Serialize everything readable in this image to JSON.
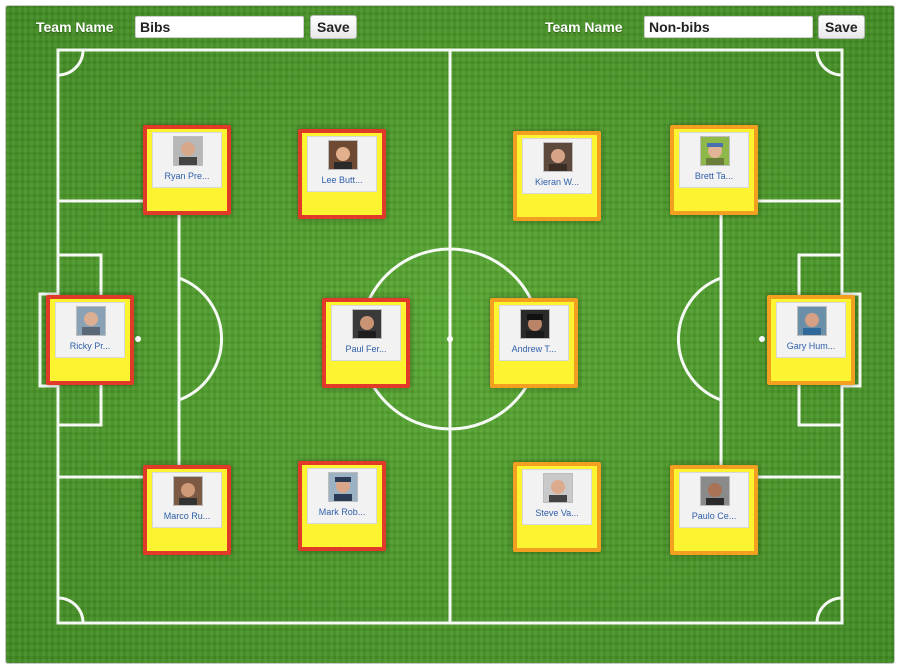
{
  "teams": {
    "left": {
      "label": "Team Name",
      "value": "Bibs",
      "save_label": "Save"
    },
    "right": {
      "label": "Team Name",
      "value": "Non-bibs",
      "save_label": "Save"
    }
  },
  "colors": {
    "bibs_border": "#e23a28",
    "nonbibs_border": "#f3a020",
    "card_fill": "#fcf430",
    "grass": "#4c9a2a",
    "lines": "#ffffff"
  },
  "players": [
    {
      "team": "bibs",
      "name": "Ryan Pre...",
      "icon": "player-avatar-icon"
    },
    {
      "team": "bibs",
      "name": "Lee Butt...",
      "icon": "player-avatar-icon"
    },
    {
      "team": "bibs",
      "name": "Ricky Pr...",
      "icon": "player-avatar-icon"
    },
    {
      "team": "bibs",
      "name": "Paul Fer...",
      "icon": "player-avatar-icon"
    },
    {
      "team": "bibs",
      "name": "Marco Ru...",
      "icon": "player-avatar-icon"
    },
    {
      "team": "bibs",
      "name": "Mark Rob...",
      "icon": "player-avatar-icon"
    },
    {
      "team": "nonbibs",
      "name": "Kieran W...",
      "icon": "player-avatar-icon"
    },
    {
      "team": "nonbibs",
      "name": "Brett Ta...",
      "icon": "player-avatar-icon"
    },
    {
      "team": "nonbibs",
      "name": "Andrew T...",
      "icon": "player-avatar-icon"
    },
    {
      "team": "nonbibs",
      "name": "Gary Hum...",
      "icon": "player-avatar-icon"
    },
    {
      "team": "nonbibs",
      "name": "Steve Va...",
      "icon": "player-avatar-icon"
    },
    {
      "team": "nonbibs",
      "name": "Paulo Ce...",
      "icon": "player-avatar-icon"
    }
  ]
}
